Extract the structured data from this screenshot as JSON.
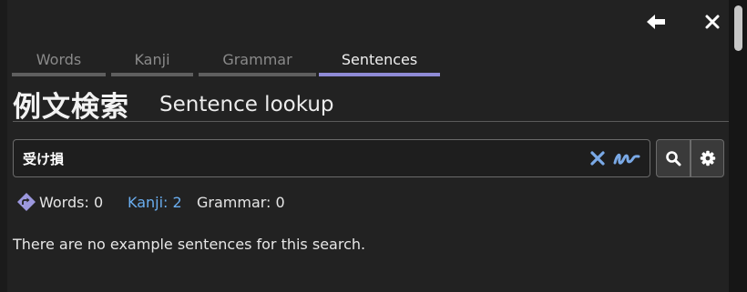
{
  "header": {
    "back_icon": "arrow-left-icon",
    "close_icon": "close-icon"
  },
  "tabs": [
    {
      "label": "Words",
      "active": false
    },
    {
      "label": "Kanji",
      "active": false
    },
    {
      "label": "Grammar",
      "active": false
    },
    {
      "label": "Sentences",
      "active": true
    }
  ],
  "title": {
    "japanese": "例文検索",
    "english": "Sentence lookup"
  },
  "search": {
    "value": "受け損",
    "clear_icon": "clear-x-icon",
    "handwriting_icon": "handwriting-icon",
    "search_icon": "magnifier-icon",
    "settings_icon": "gear-icon"
  },
  "counts": {
    "icon": "diamond-redirect-icon",
    "words": "Words: 0",
    "kanji": "Kanji: 2",
    "grammar": "Grammar: 0"
  },
  "message": "There are no example sentences for this search.",
  "colors": {
    "background": "#222222",
    "active_tab": "#8f8bd6",
    "link": "#6aaef0",
    "accent_icon": "#7aa9e6"
  }
}
